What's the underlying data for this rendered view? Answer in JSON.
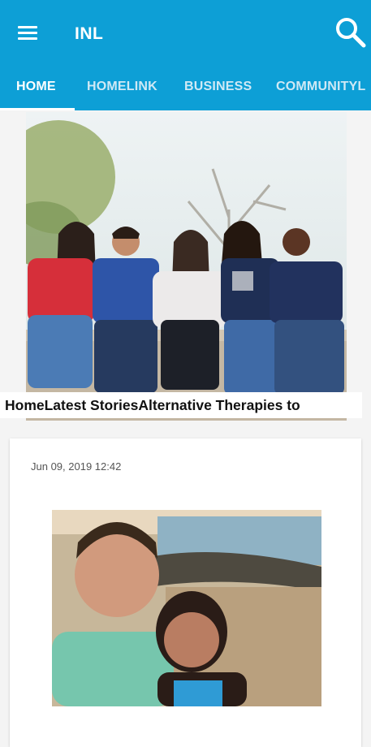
{
  "app": {
    "title": "INL"
  },
  "icons": {
    "menu": "hamburger-menu-icon",
    "search": "search-icon"
  },
  "colors": {
    "appbar": "#0d9fd6",
    "tab_inactive": "#cfe9f5",
    "tab_active": "#ffffff"
  },
  "tabs": [
    {
      "label": "HOME",
      "active": true
    },
    {
      "label": "HOMELINK",
      "active": false
    },
    {
      "label": "BUSINESS",
      "active": false
    },
    {
      "label": "COMMUNITYL",
      "active": false
    }
  ],
  "hero": {
    "caption": "HomeLatest StoriesAlternative Therapies to"
  },
  "card": {
    "date": "Jun 09, 2019 12:42"
  }
}
